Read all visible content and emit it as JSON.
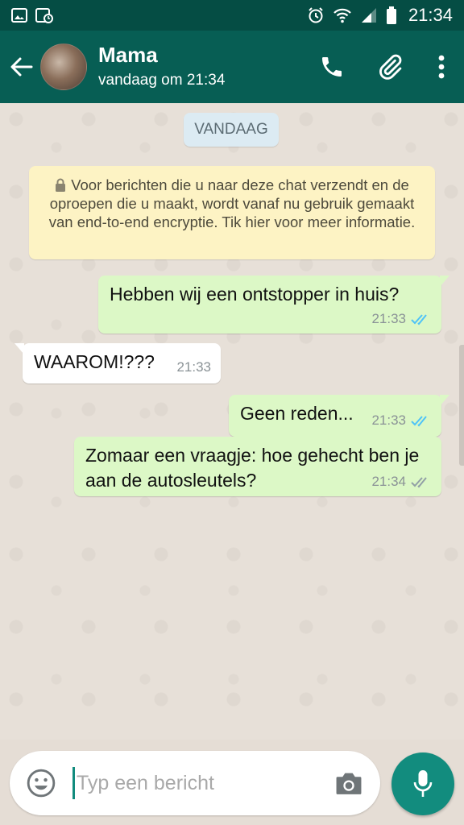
{
  "status_bar": {
    "time": "21:34",
    "icons": [
      "gallery-icon",
      "screenshot-icon",
      "alarm-icon",
      "wifi-icon",
      "signal-icon",
      "battery-icon"
    ]
  },
  "header": {
    "contact_name": "Mama",
    "last_seen": "vandaag om 21:34",
    "actions": [
      "back-arrow-icon",
      "phone-icon",
      "paperclip-icon",
      "more-vert-icon"
    ]
  },
  "chat": {
    "date_chip": "VANDAAG",
    "encryption_notice": "Voor berichten die u naar deze chat verzendt en de oproepen die u maakt, wordt vanaf nu gebruik gemaakt van end-to-end encryptie. Tik hier voor meer informatie.",
    "messages": [
      {
        "direction": "out",
        "text": "Hebben wij een ontstopper in huis?",
        "time": "21:33",
        "status": "read"
      },
      {
        "direction": "in",
        "text": "WAAROM!???",
        "time": "21:33"
      },
      {
        "direction": "out",
        "text": "Geen reden...",
        "time": "21:33",
        "status": "read"
      },
      {
        "direction": "out",
        "text": "Zomaar een vraagje: hoe gehecht ben je aan de autosleutels?",
        "time": "21:34",
        "status": "delivered"
      }
    ]
  },
  "composer": {
    "placeholder": "Typ een bericht",
    "value": ""
  },
  "colors": {
    "header": "#075e54",
    "status_bar": "#054d44",
    "outgoing_bubble": "#dcf8c6",
    "incoming_bubble": "#ffffff",
    "read_ticks": "#4fc3f7",
    "delivered_ticks": "#92a0a6",
    "fab": "#128c7e"
  }
}
